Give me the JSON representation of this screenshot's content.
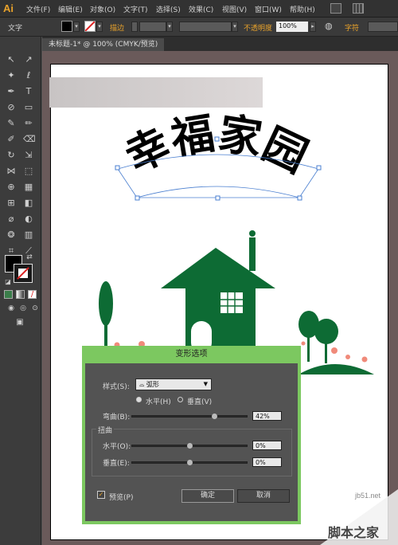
{
  "app": {
    "logo": "Ai"
  },
  "menubar": {
    "items": [
      "文件(F)",
      "编辑(E)",
      "对象(O)",
      "文字(T)",
      "选择(S)",
      "效果(C)",
      "视图(V)",
      "窗口(W)",
      "帮助(H)"
    ]
  },
  "controlbar": {
    "tool_name": "文字",
    "stroke_label": "描边",
    "opacity_label": "不透明度",
    "opacity_value": "100%",
    "char_label": "字符"
  },
  "document": {
    "tab_title": "未标题-1* @ 100% (CMYK/预览)"
  },
  "artwork": {
    "headline": "幸福家园",
    "colors": {
      "green": "#0d6b34",
      "flower": "#f08a7a"
    }
  },
  "dialog": {
    "title": "变形选项",
    "style_label": "样式(S):",
    "style_value": "弧形",
    "horizontal_label": "水平(H)",
    "vertical_label": "垂直(V)",
    "orientation": "horizontal",
    "bend_label": "弯曲(B):",
    "bend_value": "42%",
    "bend_level": 0.42,
    "distort_group_label": "扭曲",
    "distort_h_label": "水平(O):",
    "distort_h_value": "0%",
    "distort_v_label": "垂直(E):",
    "distort_v_value": "0%",
    "preview_label": "预览(P)",
    "preview_checked": true,
    "ok_label": "确定",
    "cancel_label": "取消"
  },
  "watermark": {
    "url": "jb51.net",
    "name": "脚本之家"
  }
}
